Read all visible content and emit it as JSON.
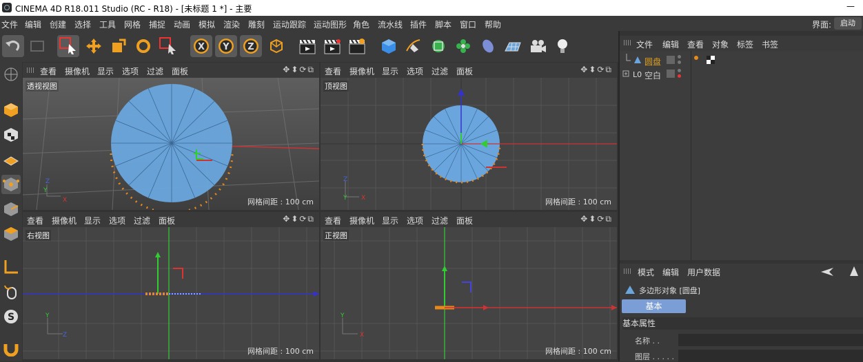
{
  "window": {
    "title": "CINEMA 4D R18.011 Studio (RC - R18) - [未标题 1 *] - 主要",
    "minimize": "—"
  },
  "menubar": {
    "items": [
      "文件",
      "编辑",
      "创建",
      "选择",
      "工具",
      "网格",
      "捕捉",
      "动画",
      "模拟",
      "渲染",
      "雕刻",
      "运动跟踪",
      "运动图形",
      "角色",
      "流水线",
      "插件",
      "脚本",
      "窗口",
      "帮助"
    ],
    "layout_label": "界面:",
    "layout_value": "启动"
  },
  "viewport_menu": [
    "查看",
    "摄像机",
    "显示",
    "选项",
    "过滤",
    "面板"
  ],
  "viewport_controls": "✥⬍⟳⧉",
  "viewports": [
    {
      "label": "透视视图",
      "grid": "网格间距 : 100 cm"
    },
    {
      "label": "顶视图",
      "grid": "网格间距 : 100 cm"
    },
    {
      "label": "右视图",
      "grid": "网格间距 : 100 cm"
    },
    {
      "label": "正视图",
      "grid": "网格间距 : 100 cm"
    }
  ],
  "object_manager": {
    "menu": [
      "文件",
      "编辑",
      "查看",
      "对象",
      "标签",
      "书签"
    ],
    "objects": [
      {
        "name": "圆盘",
        "color": "#e0a020"
      },
      {
        "name": "空白",
        "color": "#cccccc"
      }
    ]
  },
  "attribute_manager": {
    "menu": [
      "模式",
      "编辑",
      "用户数据"
    ],
    "object_type": "多边形对象 [圆盘]",
    "tab": "基本",
    "section": "基本属性",
    "fields": [
      "名称 . .",
      "图层 . . . . ."
    ]
  },
  "axes": {
    "x": "X",
    "y": "Y",
    "z": "Z"
  },
  "colors": {
    "accent": "#e88a1a",
    "axis_x": "#d33",
    "axis_y": "#3c3",
    "axis_z": "#33c",
    "mesh": "#6aa6dd"
  }
}
